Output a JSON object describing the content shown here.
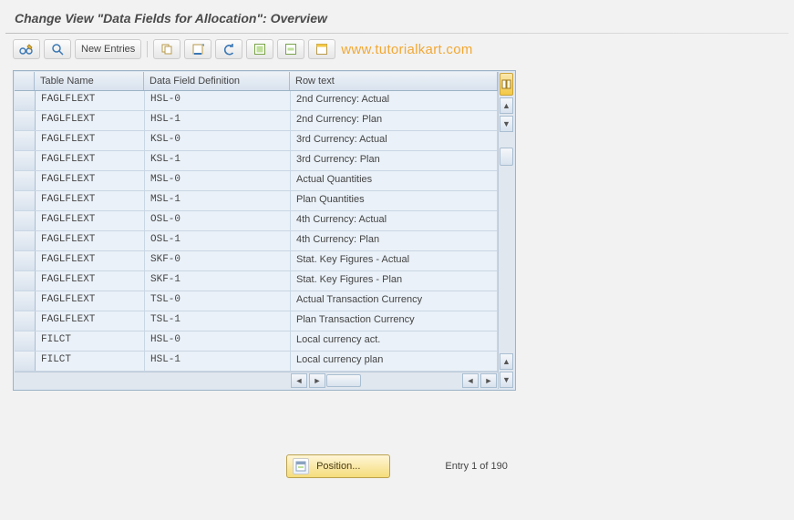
{
  "header": {
    "title": "Change View \"Data Fields for Allocation\": Overview"
  },
  "toolbar": {
    "new_entries_label": "New Entries"
  },
  "watermark": "www.tutorialkart.com",
  "grid": {
    "columns": [
      "Table Name",
      "Data Field Definition",
      "Row text"
    ],
    "rows": [
      {
        "table": "FAGLFLEXT",
        "field": "HSL-0",
        "text": "2nd Currency: Actual"
      },
      {
        "table": "FAGLFLEXT",
        "field": "HSL-1",
        "text": "2nd Currency: Plan"
      },
      {
        "table": "FAGLFLEXT",
        "field": "KSL-0",
        "text": "3rd Currency: Actual"
      },
      {
        "table": "FAGLFLEXT",
        "field": "KSL-1",
        "text": "3rd Currency: Plan"
      },
      {
        "table": "FAGLFLEXT",
        "field": "MSL-0",
        "text": "Actual Quantities"
      },
      {
        "table": "FAGLFLEXT",
        "field": "MSL-1",
        "text": "Plan Quantities"
      },
      {
        "table": "FAGLFLEXT",
        "field": "OSL-0",
        "text": "4th Currency: Actual"
      },
      {
        "table": "FAGLFLEXT",
        "field": "OSL-1",
        "text": "4th Currency: Plan"
      },
      {
        "table": "FAGLFLEXT",
        "field": "SKF-0",
        "text": "Stat. Key Figures - Actual"
      },
      {
        "table": "FAGLFLEXT",
        "field": "SKF-1",
        "text": "Stat. Key Figures - Plan"
      },
      {
        "table": "FAGLFLEXT",
        "field": "TSL-0",
        "text": "Actual Transaction Currency"
      },
      {
        "table": "FAGLFLEXT",
        "field": "TSL-1",
        "text": "Plan Transaction Currency"
      },
      {
        "table": "FILCT",
        "field": "HSL-0",
        "text": "Local currency act."
      },
      {
        "table": "FILCT",
        "field": "HSL-1",
        "text": "Local currency plan"
      }
    ]
  },
  "footer": {
    "position_label": "Position...",
    "entry_text": "Entry 1 of 190"
  }
}
